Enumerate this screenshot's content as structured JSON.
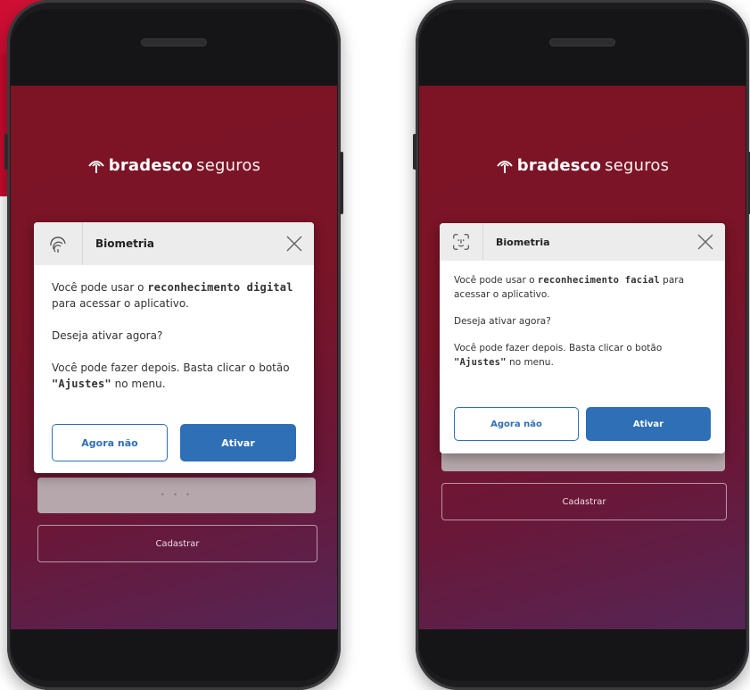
{
  "brand": {
    "bold": "bradesco",
    "light": "seguros"
  },
  "left_phone": {
    "dialog": {
      "title": "Biometria",
      "icon": "fingerprint-icon",
      "line1_pre": "Você pode usar o ",
      "line1_hl": "reconhecimento digital",
      "line1_post": " para acessar o aplicativo.",
      "question": "Deseja ativar agora?",
      "later_pre": "Você pode fazer depois. Basta clicar o botão ",
      "later_hl": "\"Ajustes\"",
      "later_post": " no menu.",
      "btn_later": "Agora não",
      "btn_activate": "Ativar"
    },
    "loading_dots": "• • •",
    "register_label": "Cadastrar"
  },
  "right_phone": {
    "dialog": {
      "title": "Biometria",
      "icon": "face-id-icon",
      "line1_pre": "Você pode usar o ",
      "line1_hl": "reconhecimento facial",
      "line1_post": " para acessar o aplicativo.",
      "question": "Deseja ativar agora?",
      "later_pre": "Você pode fazer depois. Basta clicar o botão ",
      "later_hl": "\"Ajustes\"",
      "later_post": " no menu.",
      "btn_later": "Agora não",
      "btn_activate": "Ativar"
    },
    "loading_dots": "• • •",
    "register_label": "Cadastrar"
  },
  "colors": {
    "brand_red": "#7d1424",
    "accent_blue": "#2f6fb6"
  }
}
